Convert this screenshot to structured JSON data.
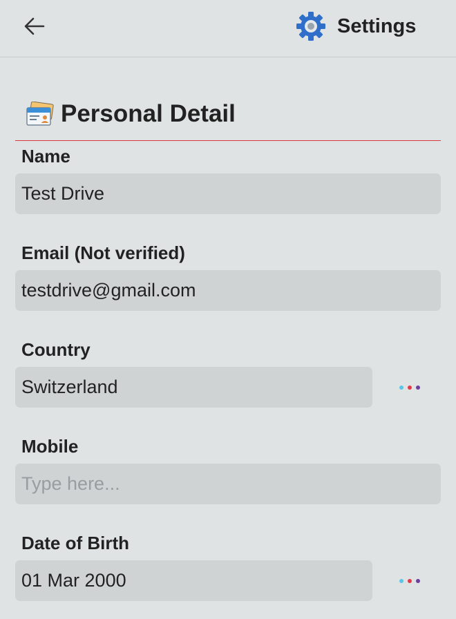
{
  "header": {
    "back_icon": "arrow-left-icon",
    "settings_icon": "gear-icon",
    "settings_label": "Settings"
  },
  "section": {
    "icon": "id-card-icon",
    "title": "Personal Detail"
  },
  "fields": {
    "name": {
      "label": "Name",
      "value": "Test Drive"
    },
    "email": {
      "label": "Email (Not verified)",
      "value": "testdrive@gmail.com"
    },
    "country": {
      "label": "Country",
      "value": "Switzerland",
      "more_icon": "more-dots-icon"
    },
    "mobile": {
      "label": "Mobile",
      "value": "",
      "placeholder": "Type here..."
    },
    "dob": {
      "label": "Date of Birth",
      "value": "01 Mar 2000",
      "more_icon": "more-dots-icon"
    }
  },
  "colors": {
    "background": "#dfe3e4",
    "field_background": "#cfd3d4",
    "divider": "#d9363e",
    "gear": "#2f6fca",
    "dot_1": "#5bc6e6",
    "dot_2": "#e23a4a",
    "dot_3": "#6b3fa0"
  }
}
